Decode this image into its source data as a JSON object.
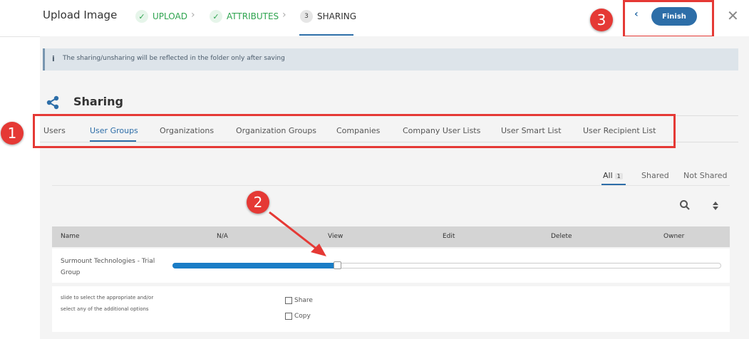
{
  "header": {
    "title": "Upload Image",
    "steps": [
      {
        "label": "UPLOAD",
        "marker": "✓"
      },
      {
        "label": "ATTRIBUTES",
        "marker": "✓"
      },
      {
        "label": "SHARING",
        "marker": "3"
      }
    ],
    "step_separator": "›",
    "back_icon": "‹",
    "finish_label": "Finish",
    "close_icon": "✕"
  },
  "banner": {
    "icon": "i",
    "text": "The sharing/unsharing will be reflected in the folder only after saving"
  },
  "section": {
    "title": "Sharing"
  },
  "tabs": [
    "Users",
    "User Groups",
    "Organizations",
    "Organization Groups",
    "Companies",
    "Company User Lists",
    "User Smart List",
    "User Recipient List"
  ],
  "active_tab": "User Groups",
  "filters": {
    "all": "All",
    "all_count": "1",
    "shared": "Shared",
    "not_shared": "Not Shared"
  },
  "toolbar": {
    "search_icon": "search-icon",
    "sort_icon": "sort-icon"
  },
  "table": {
    "columns": [
      "Name",
      "N/A",
      "View",
      "Edit",
      "Delete",
      "Owner"
    ],
    "row": {
      "name": "Surmount Technologies - Trial Group",
      "permission": "View",
      "slider_fraction": 0.3
    }
  },
  "options": {
    "hint": "slide to select the appropriate and/or select any of the additional options",
    "share": "Share",
    "copy": "Copy"
  },
  "annotations": {
    "badge1": "1",
    "badge2": "2",
    "badge3": "3"
  },
  "colors": {
    "accent": "#2d6ea8",
    "success": "#2ea44f",
    "annotation": "#e53935",
    "slider_fill": "#1a7dc6"
  }
}
